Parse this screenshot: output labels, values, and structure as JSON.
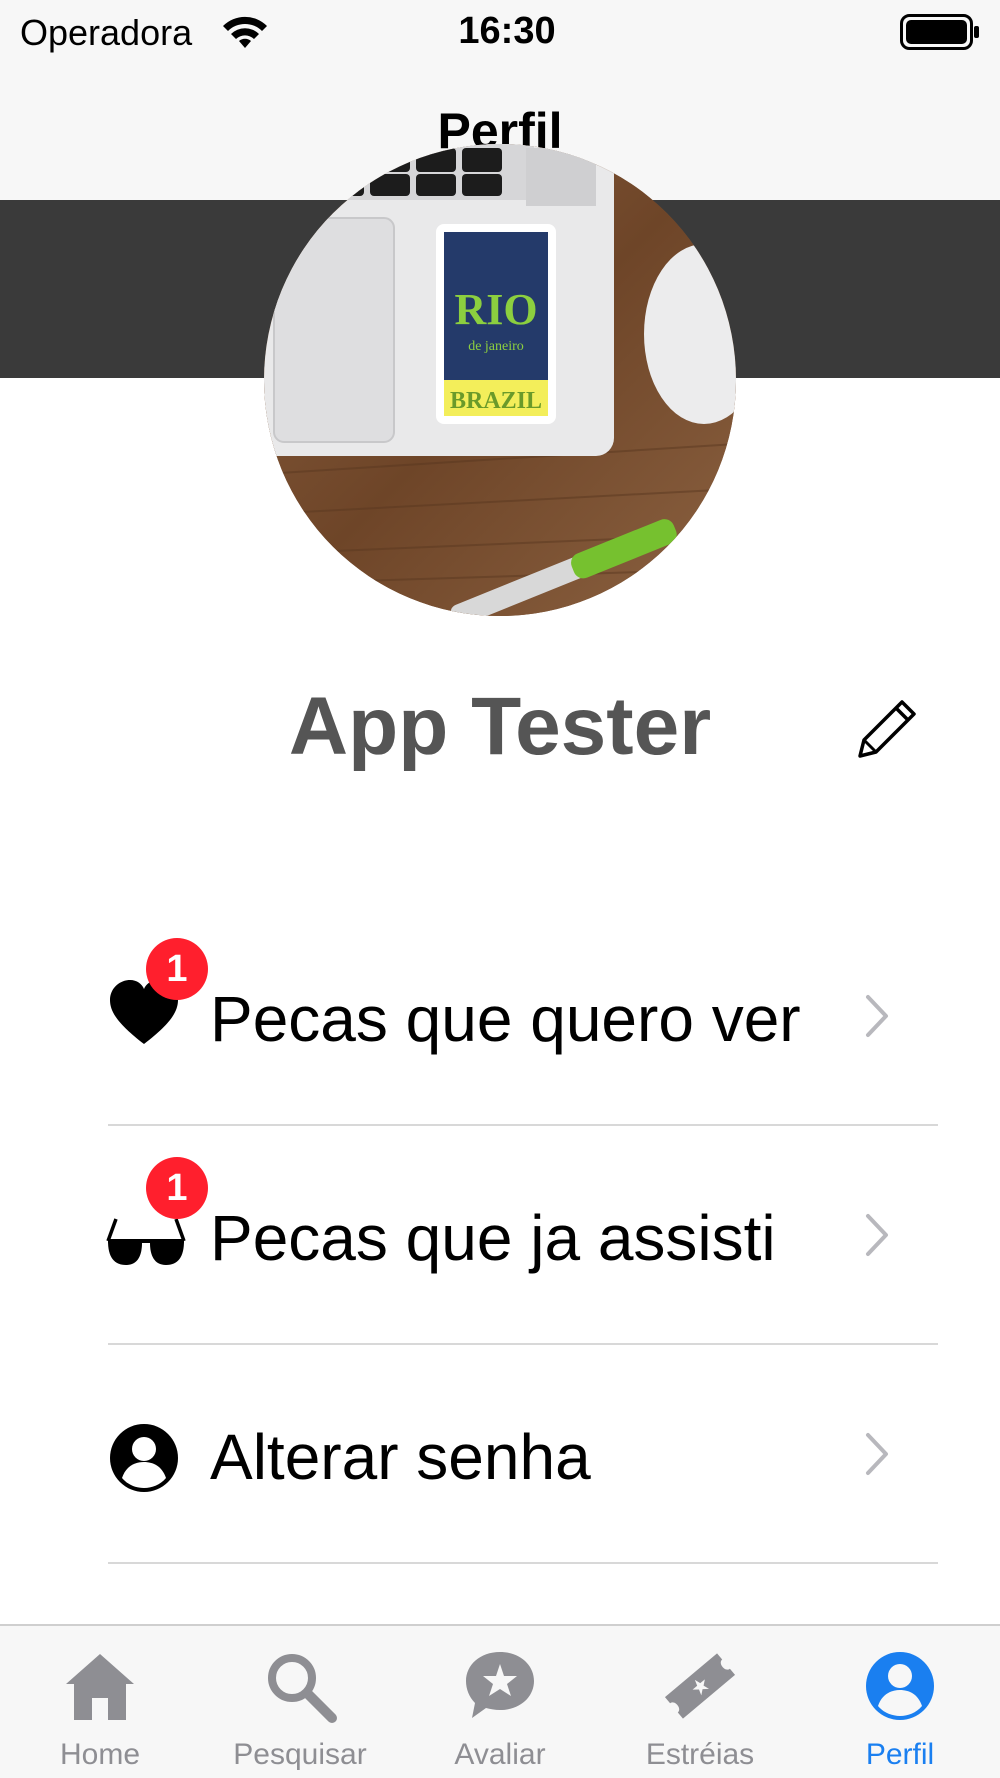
{
  "status_bar": {
    "carrier": "Operadora",
    "time": "16:30"
  },
  "nav": {
    "title": "Perfil"
  },
  "profile": {
    "name": "App Tester",
    "avatar_sticker_top": "RIO",
    "avatar_sticker_mid": "de janeiro",
    "avatar_sticker_bottom": "BRAZIL"
  },
  "menu": {
    "items": [
      {
        "label": "Pecas que quero ver",
        "icon": "heart-icon",
        "badge": "1"
      },
      {
        "label": "Pecas que ja assisti",
        "icon": "glasses-icon",
        "badge": "1"
      },
      {
        "label": "Alterar senha",
        "icon": "user-circle-icon",
        "badge": ""
      }
    ]
  },
  "tabs": [
    {
      "label": "Home",
      "icon": "home-icon",
      "active": false
    },
    {
      "label": "Pesquisar",
      "icon": "search-icon",
      "active": false
    },
    {
      "label": "Avaliar",
      "icon": "star-chat-icon",
      "active": false
    },
    {
      "label": "Estréias",
      "icon": "ticket-icon",
      "active": false
    },
    {
      "label": "Perfil",
      "icon": "profile-icon",
      "active": true
    }
  ],
  "colors": {
    "accent": "#1a7ff0",
    "badge": "#ff1f2d",
    "header_band": "#3a3a3a",
    "name_text": "#555555",
    "inactive_tab": "#8e8e93"
  }
}
